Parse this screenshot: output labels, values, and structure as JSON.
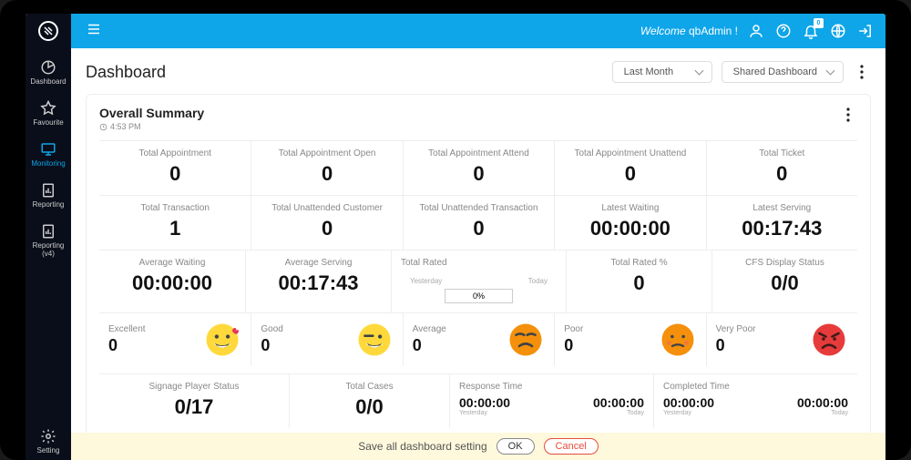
{
  "topbar": {
    "welcome_prefix": "Welcome ",
    "username": "qbAdmin !",
    "notification_count": "0"
  },
  "sidebar": {
    "items": [
      {
        "label": "Dashboard"
      },
      {
        "label": "Favourite"
      },
      {
        "label": "Monitoring"
      },
      {
        "label": "Reporting"
      },
      {
        "label": "Reporting (v4)"
      }
    ],
    "bottom": {
      "label": "Setting"
    }
  },
  "page": {
    "title": "Dashboard",
    "period_select": "Last Month",
    "dashboard_select": "Shared Dashboard"
  },
  "summary": {
    "title": "Overall Summary",
    "time": "4:53 PM",
    "row1": [
      {
        "label": "Total Appointment",
        "value": "0"
      },
      {
        "label": "Total Appointment Open",
        "value": "0"
      },
      {
        "label": "Total Appointment Attend",
        "value": "0"
      },
      {
        "label": "Total Appointment Unattend",
        "value": "0"
      },
      {
        "label": "Total Ticket",
        "value": "0"
      }
    ],
    "row2": [
      {
        "label": "Total Transaction",
        "value": "1"
      },
      {
        "label": "Total Unattended Customer",
        "value": "0"
      },
      {
        "label": "Total Unattended Transaction",
        "value": "0"
      },
      {
        "label": "Latest Waiting",
        "value": "00:00:00"
      },
      {
        "label": "Latest Serving",
        "value": "00:17:43"
      }
    ],
    "row3": {
      "avg_waiting": {
        "label": "Average Waiting",
        "value": "00:00:00"
      },
      "avg_serving": {
        "label": "Average Serving",
        "value": "00:17:43"
      },
      "total_rated": {
        "label": "Total Rated",
        "yesterday_label": "Yesterday",
        "today_label": "Today",
        "progress": "0%"
      },
      "total_rated_pct": {
        "label": "Total Rated %",
        "value": "0"
      },
      "cfs": {
        "label": "CFS Display Status",
        "value": "0/0"
      }
    },
    "ratings": [
      {
        "label": "Excellent",
        "value": "0"
      },
      {
        "label": "Good",
        "value": "0"
      },
      {
        "label": "Average",
        "value": "0"
      },
      {
        "label": "Poor",
        "value": "0"
      },
      {
        "label": "Very Poor",
        "value": "0"
      }
    ],
    "row4": {
      "signage": {
        "label": "Signage Player Status",
        "value": "0/17"
      },
      "total_cases": {
        "label": "Total Cases",
        "value": "0/0"
      },
      "response_time": {
        "label": "Response Time",
        "val1": "00:00:00",
        "val2": "00:00:00",
        "sub1": "Yesterday",
        "sub2": "Today"
      },
      "completed_time": {
        "label": "Completed Time",
        "val1": "00:00:00",
        "val2": "00:00:00",
        "sub1": "Yesterday",
        "sub2": "Today"
      }
    }
  },
  "banner": {
    "text": "Save all dashboard setting",
    "ok": "OK",
    "cancel": "Cancel"
  }
}
